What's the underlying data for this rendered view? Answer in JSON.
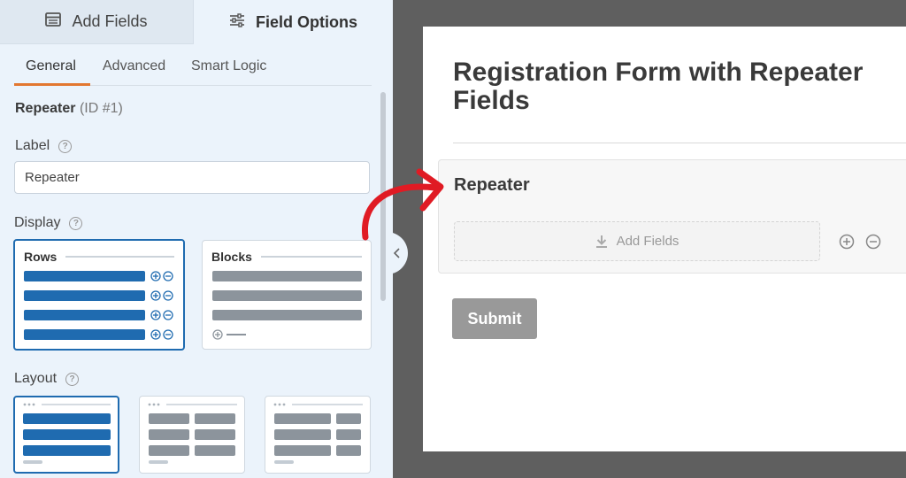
{
  "tabs": {
    "add_fields": "Add Fields",
    "field_options": "Field Options"
  },
  "subtabs": {
    "general": "General",
    "advanced": "Advanced",
    "smart_logic": "Smart Logic"
  },
  "field": {
    "name": "Repeater",
    "id_text": "(ID #1)"
  },
  "label_section": {
    "title": "Label",
    "help": "?",
    "value": "Repeater"
  },
  "display_section": {
    "title": "Display",
    "help": "?",
    "options": [
      {
        "label": "Rows",
        "selected": true
      },
      {
        "label": "Blocks",
        "selected": false
      }
    ]
  },
  "layout_section": {
    "title": "Layout",
    "help": "?",
    "options_count_visible": 3,
    "selected_index": 0
  },
  "form_preview": {
    "title": "Registration Form with Repeater Fields",
    "repeater_label": "Repeater",
    "add_fields_label": "Add Fields",
    "submit_label": "Submit"
  },
  "colors": {
    "accent_blue": "#1f6bb0",
    "tab_underline": "#e27730",
    "arrow_red": "#e01b24",
    "submit_gray": "#999999"
  },
  "icons": {
    "add_fields_tab": "table-icon",
    "field_options_tab": "sliders-icon",
    "collapse": "chevron-left-icon",
    "add_fields_box": "download-icon",
    "repeater_add": "plus-circle-icon",
    "repeater_remove": "minus-circle-icon"
  }
}
